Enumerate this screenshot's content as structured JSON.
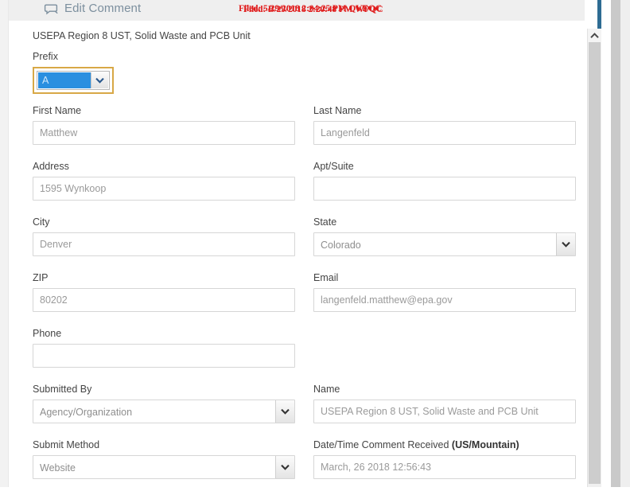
{
  "header": {
    "title": "Edit Comment",
    "icon": "comment-bubble-icon",
    "accent_color": "#7c8f9e",
    "bar_color": "#efefef"
  },
  "stamps": {
    "color": "#e01b1b",
    "line_a": "Filed: 5/29/2018 2:04:25 PM QVEQC",
    "line_b": "Filed: B/29/2018 2:20:48 PM WPQC"
  },
  "org_line": "USEPA Region 8 UST, Solid Waste and PCB Unit",
  "form": {
    "prefix": {
      "label": "Prefix",
      "value": "A",
      "focused": true,
      "focus_color": "#d8a846",
      "selection_color": "#2a8fe0"
    },
    "first_name": {
      "label": "First Name",
      "value": "Matthew"
    },
    "last_name": {
      "label": "Last Name",
      "value": "Langenfeld"
    },
    "address": {
      "label": "Address",
      "value": "1595 Wynkoop"
    },
    "apt_suite": {
      "label": "Apt/Suite",
      "value": ""
    },
    "city": {
      "label": "City",
      "value": "Denver"
    },
    "state": {
      "label": "State",
      "value": "Colorado"
    },
    "zip": {
      "label": "ZIP",
      "value": "80202"
    },
    "email": {
      "label": "Email",
      "value": "langenfeld.matthew@epa.gov"
    },
    "phone": {
      "label": "Phone",
      "value": ""
    },
    "submitted_by": {
      "label": "Submitted By",
      "value": "Agency/Organization"
    },
    "name": {
      "label": "Name",
      "value": "USEPA Region 8 UST, Solid Waste and PCB Unit"
    },
    "submit_method": {
      "label": "Submit Method",
      "value": "Website"
    },
    "date_time": {
      "label": "Date/Time Comment Received ",
      "label_bold": "(US/Mountain)",
      "value": "March, 26 2018 12:56:43"
    }
  },
  "scrollbar": {
    "up_arrow": "chevron-up-icon"
  }
}
